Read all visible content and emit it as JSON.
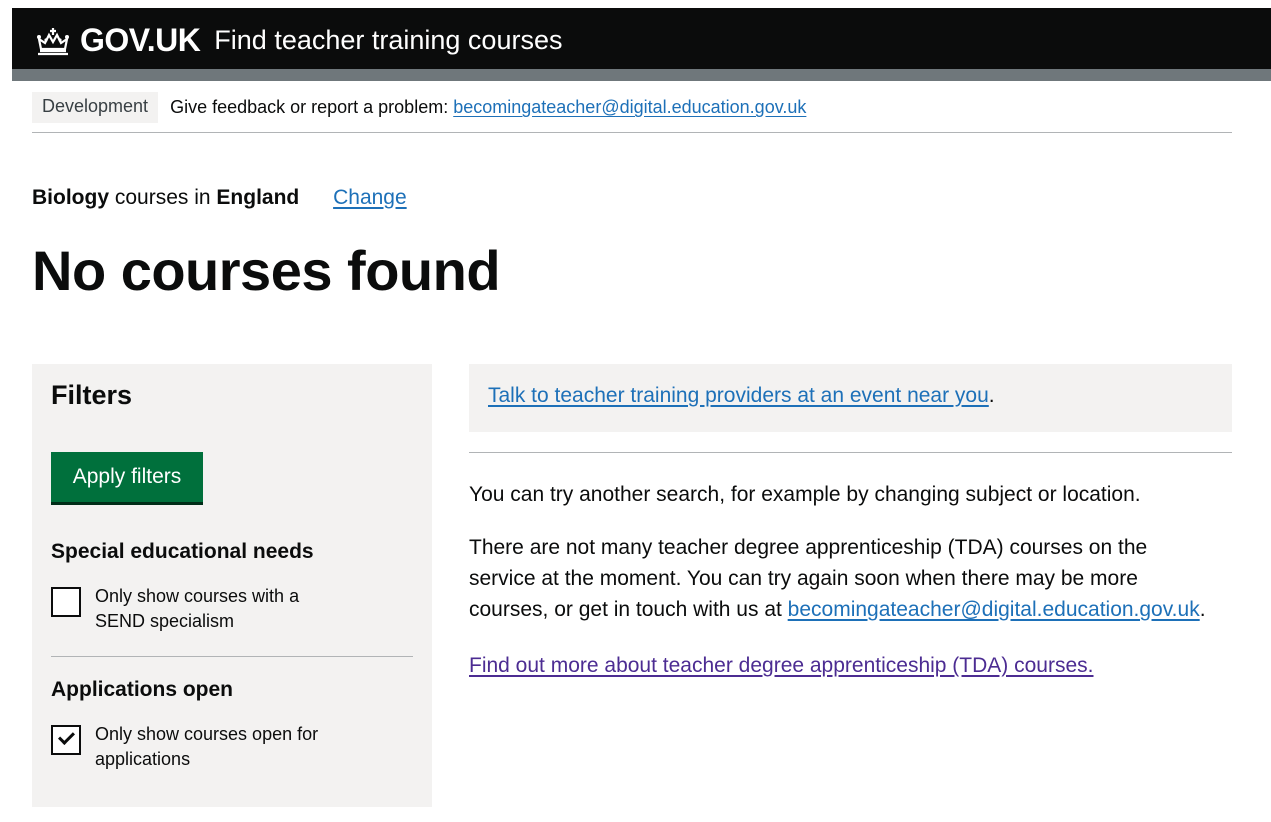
{
  "header": {
    "logo_text": "GOV.UK",
    "service_name": "Find teacher training courses",
    "crown_icon": "crown-icon"
  },
  "phase_banner": {
    "tag": "Development",
    "text": "Give feedback or report a problem:",
    "email": "becomingateacher@digital.education.gov.uk"
  },
  "search_context": {
    "subject": "Biology",
    "middle": "courses in",
    "location": "England",
    "change_link": "Change"
  },
  "page_title": "No courses found",
  "filters": {
    "title": "Filters",
    "apply_button": "Apply filters",
    "sections": [
      {
        "title": "Special educational needs",
        "checkbox_label": "Only show courses with a SEND specialism",
        "checked": false
      },
      {
        "title": "Applications open",
        "checkbox_label": "Only show courses open for applications",
        "checked": true
      }
    ]
  },
  "results": {
    "event_link": "Talk to teacher training providers at an event near you",
    "event_suffix": ".",
    "para_1": "You can try another search, for example by changing subject or location.",
    "para_2": "There are not many teacher degree apprenticeship (TDA) courses on the service at the moment. You can try again soon when there may be more courses, or get in touch with us at",
    "para_2_email": "becomingateacher@digital.education.gov.uk",
    "para_2_suffix": ".",
    "tda_link": "Find out more about teacher degree apprenticeship (TDA) courses."
  },
  "colors": {
    "header_bg": "#0b0c0c",
    "link": "#1d70b8",
    "visited_link": "#4c2c92",
    "button_green": "#00703c",
    "panel_grey": "#f3f2f1"
  }
}
